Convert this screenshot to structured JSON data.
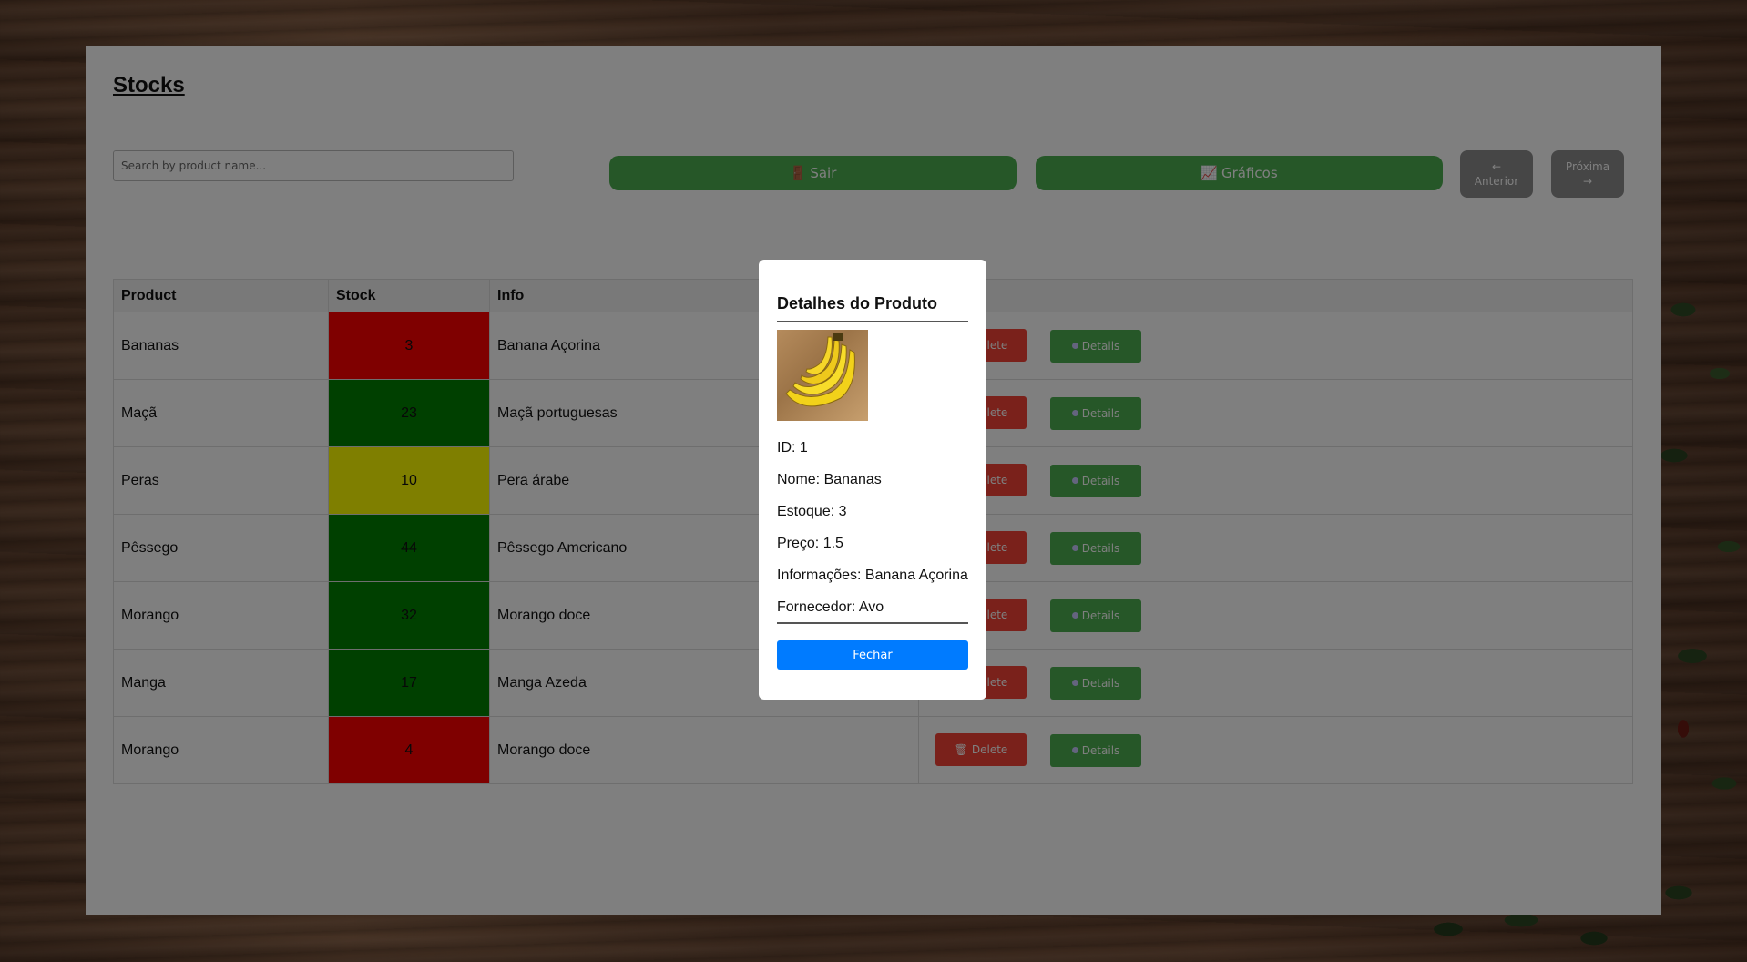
{
  "page": {
    "title": "Stocks",
    "search_placeholder": "Search by product name..."
  },
  "toolbar": {
    "sair_icon": "🚪",
    "sair_label": "Sair",
    "graficos_icon": "📈",
    "graficos_label": "Gráficos",
    "prev_arrow": "←",
    "prev_label": "Anterior",
    "next_label": "Próxima",
    "next_arrow": "→"
  },
  "table": {
    "headers": [
      "Product",
      "Stock",
      "Info",
      ""
    ],
    "delete_label": "Delete",
    "details_label": "Details",
    "rows": [
      {
        "product": "Bananas",
        "stock": "3",
        "info": "Banana Açorina",
        "level": "low"
      },
      {
        "product": "Maçã",
        "stock": "23",
        "info": "Maçã portuguesas",
        "level": "high"
      },
      {
        "product": "Peras",
        "stock": "10",
        "info": "Pera árabe",
        "level": "medium"
      },
      {
        "product": "Pêssego",
        "stock": "44",
        "info": "Pêssego Americano",
        "level": "high"
      },
      {
        "product": "Morango",
        "stock": "32",
        "info": "Morango doce",
        "level": "high"
      },
      {
        "product": "Manga",
        "stock": "17",
        "info": "Manga Azeda",
        "level": "high"
      },
      {
        "product": "Morango",
        "stock": "4",
        "info": "Morango doce",
        "level": "low"
      }
    ]
  },
  "stock_colors": {
    "low": "#ff0000",
    "medium": "#ffff00",
    "high": "#008000"
  },
  "modal": {
    "title": "Detalhes do Produto",
    "image_alt": "banana-image",
    "id_line": "ID: 1",
    "nome_line": "Nome: Bananas",
    "estoque_line": "Estoque: 3",
    "preco_line": "Preço: 1.5",
    "info_line": "Informações: Banana Açorina",
    "fornecedor_line": "Fornecedor: Avo",
    "close_label": "Fechar"
  }
}
